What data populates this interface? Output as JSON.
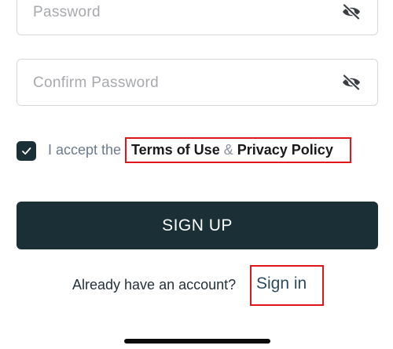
{
  "form": {
    "password": {
      "placeholder": "Password",
      "value": ""
    },
    "confirm_password": {
      "placeholder": "Confirm Password",
      "value": ""
    }
  },
  "terms": {
    "checked": true,
    "prefix": "I accept the",
    "terms_link": "Terms of Use",
    "ampersand": "&",
    "privacy_link": "Privacy Policy"
  },
  "signup_button": {
    "label": "SIGN UP"
  },
  "account": {
    "prompt": "Already have an account?",
    "signin_link": "Sign in"
  },
  "icons": {
    "password_toggle": "eye-slash-icon",
    "confirm_toggle": "eye-slash-icon",
    "checkbox": "checkmark-icon"
  },
  "colors": {
    "primary": "#1b2f37",
    "highlight_border": "#e0161b",
    "placeholder": "#a7a9ad"
  }
}
